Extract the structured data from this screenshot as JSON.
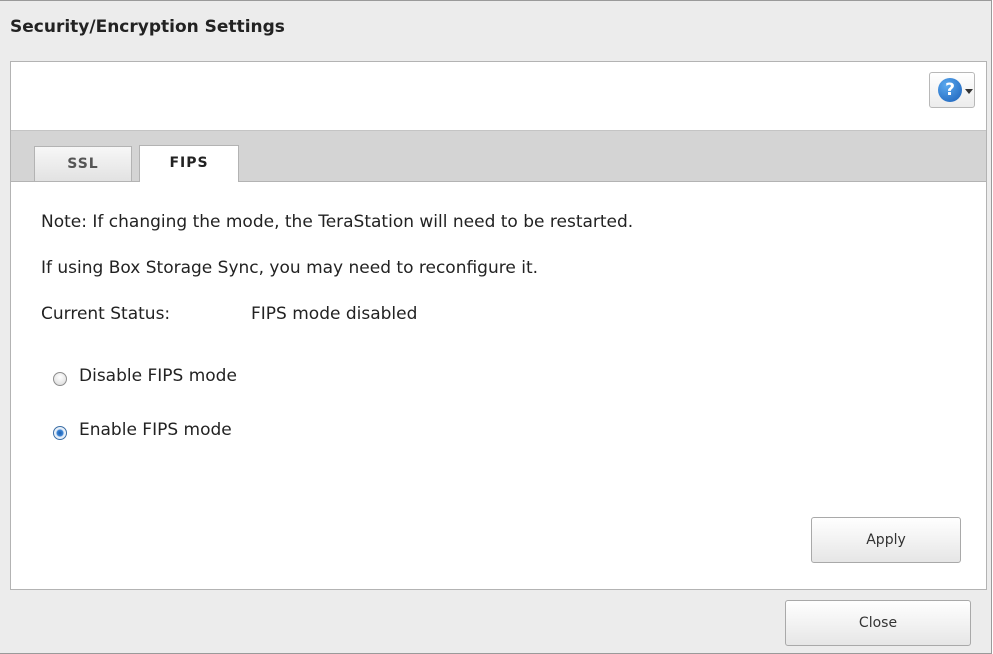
{
  "dialog": {
    "title": "Security/Encryption Settings"
  },
  "help": {
    "icon": "help-icon",
    "glyph": "?"
  },
  "tabs": [
    {
      "label": "SSL",
      "active": false
    },
    {
      "label": "FIPS",
      "active": true
    }
  ],
  "fips": {
    "note_line1": "Note: If changing the mode, the TeraStation will need to be restarted.",
    "note_line2": "If using Box Storage Sync, you may need to reconfigure it.",
    "status_label": "Current Status:",
    "status_value": "FIPS mode disabled",
    "options": [
      {
        "label": "Disable FIPS mode",
        "checked": false
      },
      {
        "label": "Enable FIPS mode",
        "checked": true
      }
    ],
    "apply_label": "Apply"
  },
  "footer": {
    "close_label": "Close"
  }
}
